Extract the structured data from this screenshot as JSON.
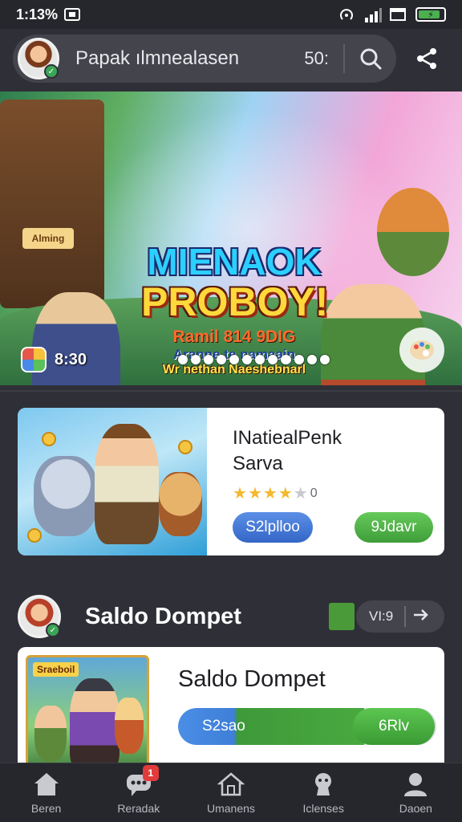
{
  "status_bar": {
    "time": "1:13%",
    "icons": [
      "screenshot-icon",
      "hotspot-icon",
      "signal-icon",
      "window-icon",
      "battery-icon"
    ]
  },
  "header": {
    "search_text": "Papak ılmnealasen",
    "count": "50:",
    "icons": [
      "avatar",
      "search-icon",
      "share-icon"
    ]
  },
  "banner": {
    "title_line1": "MIENAOK",
    "title_line2": "PROBOY!",
    "sub1": "Ramil 814 9DIG",
    "sub2": "Aranne te namaain",
    "sub3": "Wr nethan Naeshebnarl",
    "tower_sign": "Alming",
    "time": "8:30",
    "dots_count": 12,
    "active_dot": 8
  },
  "card1": {
    "title": "INatiealPenk",
    "subtitle": "Sarva",
    "rating": 4,
    "rating_value": "0",
    "primary_button": "S2lplloo",
    "secondary_button": "9Jdavr"
  },
  "section": {
    "title": "Saldo Dompet",
    "control_value": "VI:9",
    "icons": [
      "avatar",
      "arrow-right-icon"
    ]
  },
  "card2": {
    "tag": "Sraeboil",
    "title": "Saldo Dompet",
    "progress_label": "S2sao",
    "progress": 0.72,
    "button": "6Rlv"
  },
  "nav": [
    {
      "label": "Beren",
      "icon": "home-icon",
      "badge": ""
    },
    {
      "label": "Reradak",
      "icon": "chat-icon",
      "badge": "1"
    },
    {
      "label": "Umanens",
      "icon": "house-outline-icon",
      "badge": ""
    },
    {
      "label": "Iclenses",
      "icon": "character-icon",
      "badge": ""
    },
    {
      "label": "Daoen",
      "icon": "profile-icon",
      "badge": ""
    }
  ],
  "colors": {
    "background": "#2f3037",
    "card": "#ffffff",
    "accent_blue": "#3f7fd8",
    "accent_green": "#49a93f",
    "badge_red": "#e23b3b"
  }
}
